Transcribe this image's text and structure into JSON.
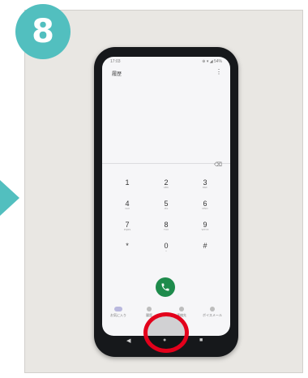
{
  "step": {
    "number": "8"
  },
  "status_bar": {
    "time": "17:03",
    "icons": "⊕ ▾ ◢ 54%"
  },
  "dialer": {
    "title": "履歴",
    "keys": [
      {
        "digit": "1",
        "sub": ""
      },
      {
        "digit": "2",
        "sub": "ABC"
      },
      {
        "digit": "3",
        "sub": "DEF"
      },
      {
        "digit": "4",
        "sub": "GHI"
      },
      {
        "digit": "5",
        "sub": "JKL"
      },
      {
        "digit": "6",
        "sub": "MNO"
      },
      {
        "digit": "7",
        "sub": "PQRS"
      },
      {
        "digit": "8",
        "sub": "TUV"
      },
      {
        "digit": "9",
        "sub": "WXYZ"
      },
      {
        "digit": "*",
        "sub": ""
      },
      {
        "digit": "0",
        "sub": "+"
      },
      {
        "digit": "#",
        "sub": ""
      }
    ],
    "tabs": [
      "お気に入り",
      "履歴",
      "連絡先",
      "ボイスメール"
    ]
  },
  "nav": {
    "back": "◀",
    "home": "●",
    "recents": "■"
  },
  "colors": {
    "badge": "#52bfbf",
    "highlight": "#e3001b",
    "call": "#1e8b4c"
  }
}
